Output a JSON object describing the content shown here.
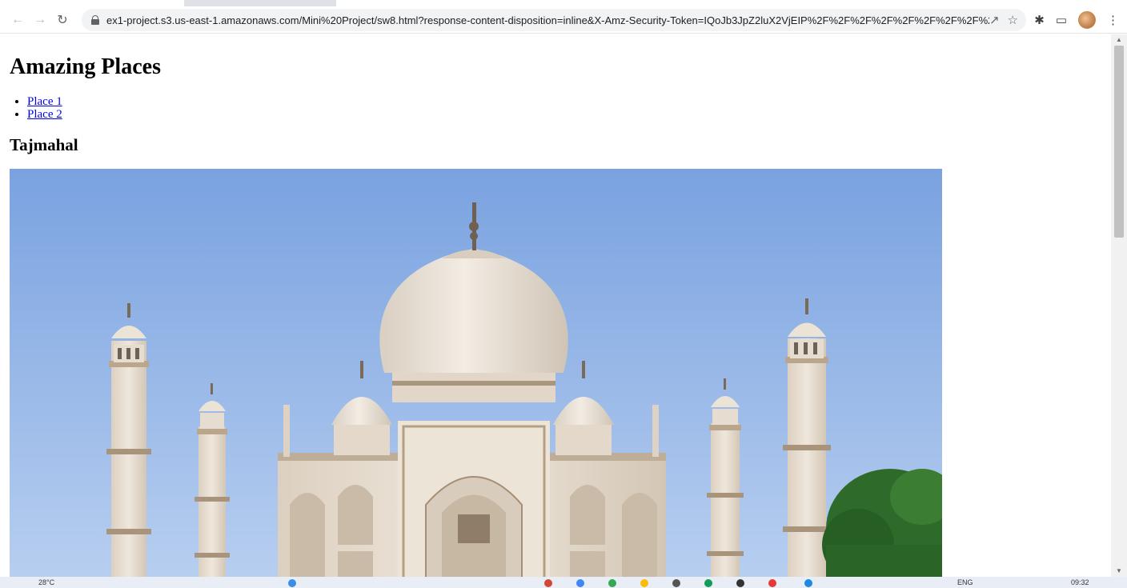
{
  "browser": {
    "url": "ex1-project.s3.us-east-1.amazonaws.com/Mini%20Project/sw8.html?response-content-disposition=inline&X-Amz-Security-Token=IQoJb3JpZ2luX2VjEIP%2F%2F%2F%2F%2F%2F%2F%2F%2F%2F..."
  },
  "page": {
    "title": "Amazing Places",
    "links": [
      "Place 1",
      "Place 2"
    ],
    "place_heading": "Tajmahal"
  },
  "taskbar": {
    "weather": "28°C",
    "language": "ENG",
    "time": "09:32"
  },
  "colors": {
    "link": "#0000ee",
    "sky_top": "#7aa2e0",
    "sky_bottom": "#b8cff0",
    "marble": "#e8ddd0"
  }
}
